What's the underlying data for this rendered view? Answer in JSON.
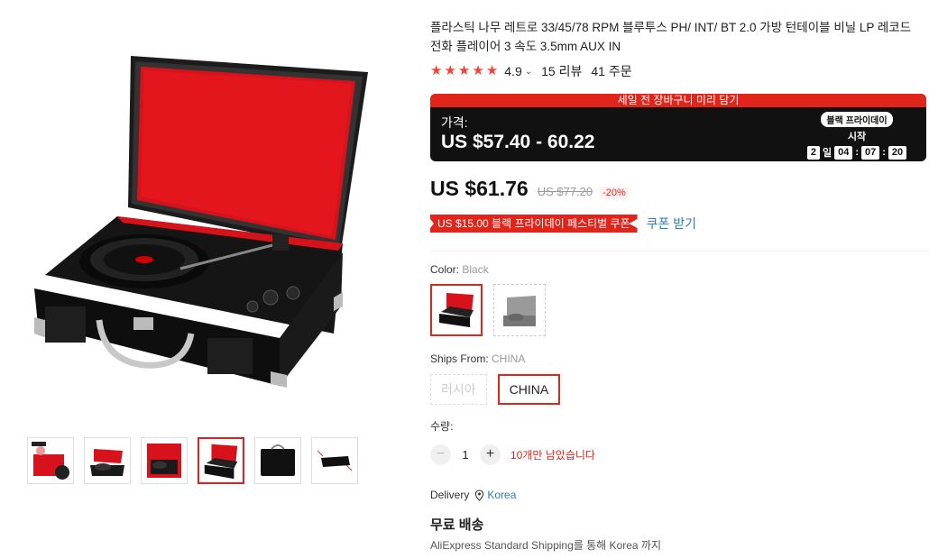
{
  "product": {
    "title": "플라스틱 나무 레트로 33/45/78 RPM 블루투스 PH/ INT/ BT 2.0 가방 턴테이블 비닐 LP 레코드 전화 플레이어 3 속도 3.5mm AUX IN",
    "rating": "4.9",
    "reviews": "15 리뷰",
    "orders": "41 주문"
  },
  "promo": {
    "banner": "세일 전 장바구니 미리 담기",
    "price_label": "가격:",
    "price_range": "US $57.40 - 60.22",
    "badge": "블랙 프라이데이",
    "start_label": "시작",
    "countdown": {
      "days": "2",
      "day_unit": "일",
      "hours": "04",
      "minutes": "07",
      "seconds": "20"
    }
  },
  "pricing": {
    "current": "US $61.76",
    "original": "US $77.20",
    "discount": "-20%"
  },
  "coupon": {
    "text": "US $15.00 블랙 프라이데이 페스티벌 쿠폰",
    "link": "쿠폰 받기"
  },
  "color": {
    "label": "Color: ",
    "value": "Black"
  },
  "ships_from": {
    "label": "Ships From: ",
    "value": "CHINA",
    "options": [
      "러시아",
      "CHINA"
    ]
  },
  "quantity": {
    "label": "수량:",
    "value": "1",
    "minus": "−",
    "plus": "+",
    "stock_note": "10개만 남았습니다"
  },
  "delivery": {
    "label": "Delivery",
    "location": "Korea"
  },
  "shipping": {
    "title": "무료 배송",
    "desc": "AliExpress Standard Shipping를 통해 Korea 까지"
  },
  "colors": {
    "accent": "#e1251b",
    "link": "#2e7dbb",
    "case_red": "#d8121a",
    "case_black": "#1a1a1a"
  }
}
